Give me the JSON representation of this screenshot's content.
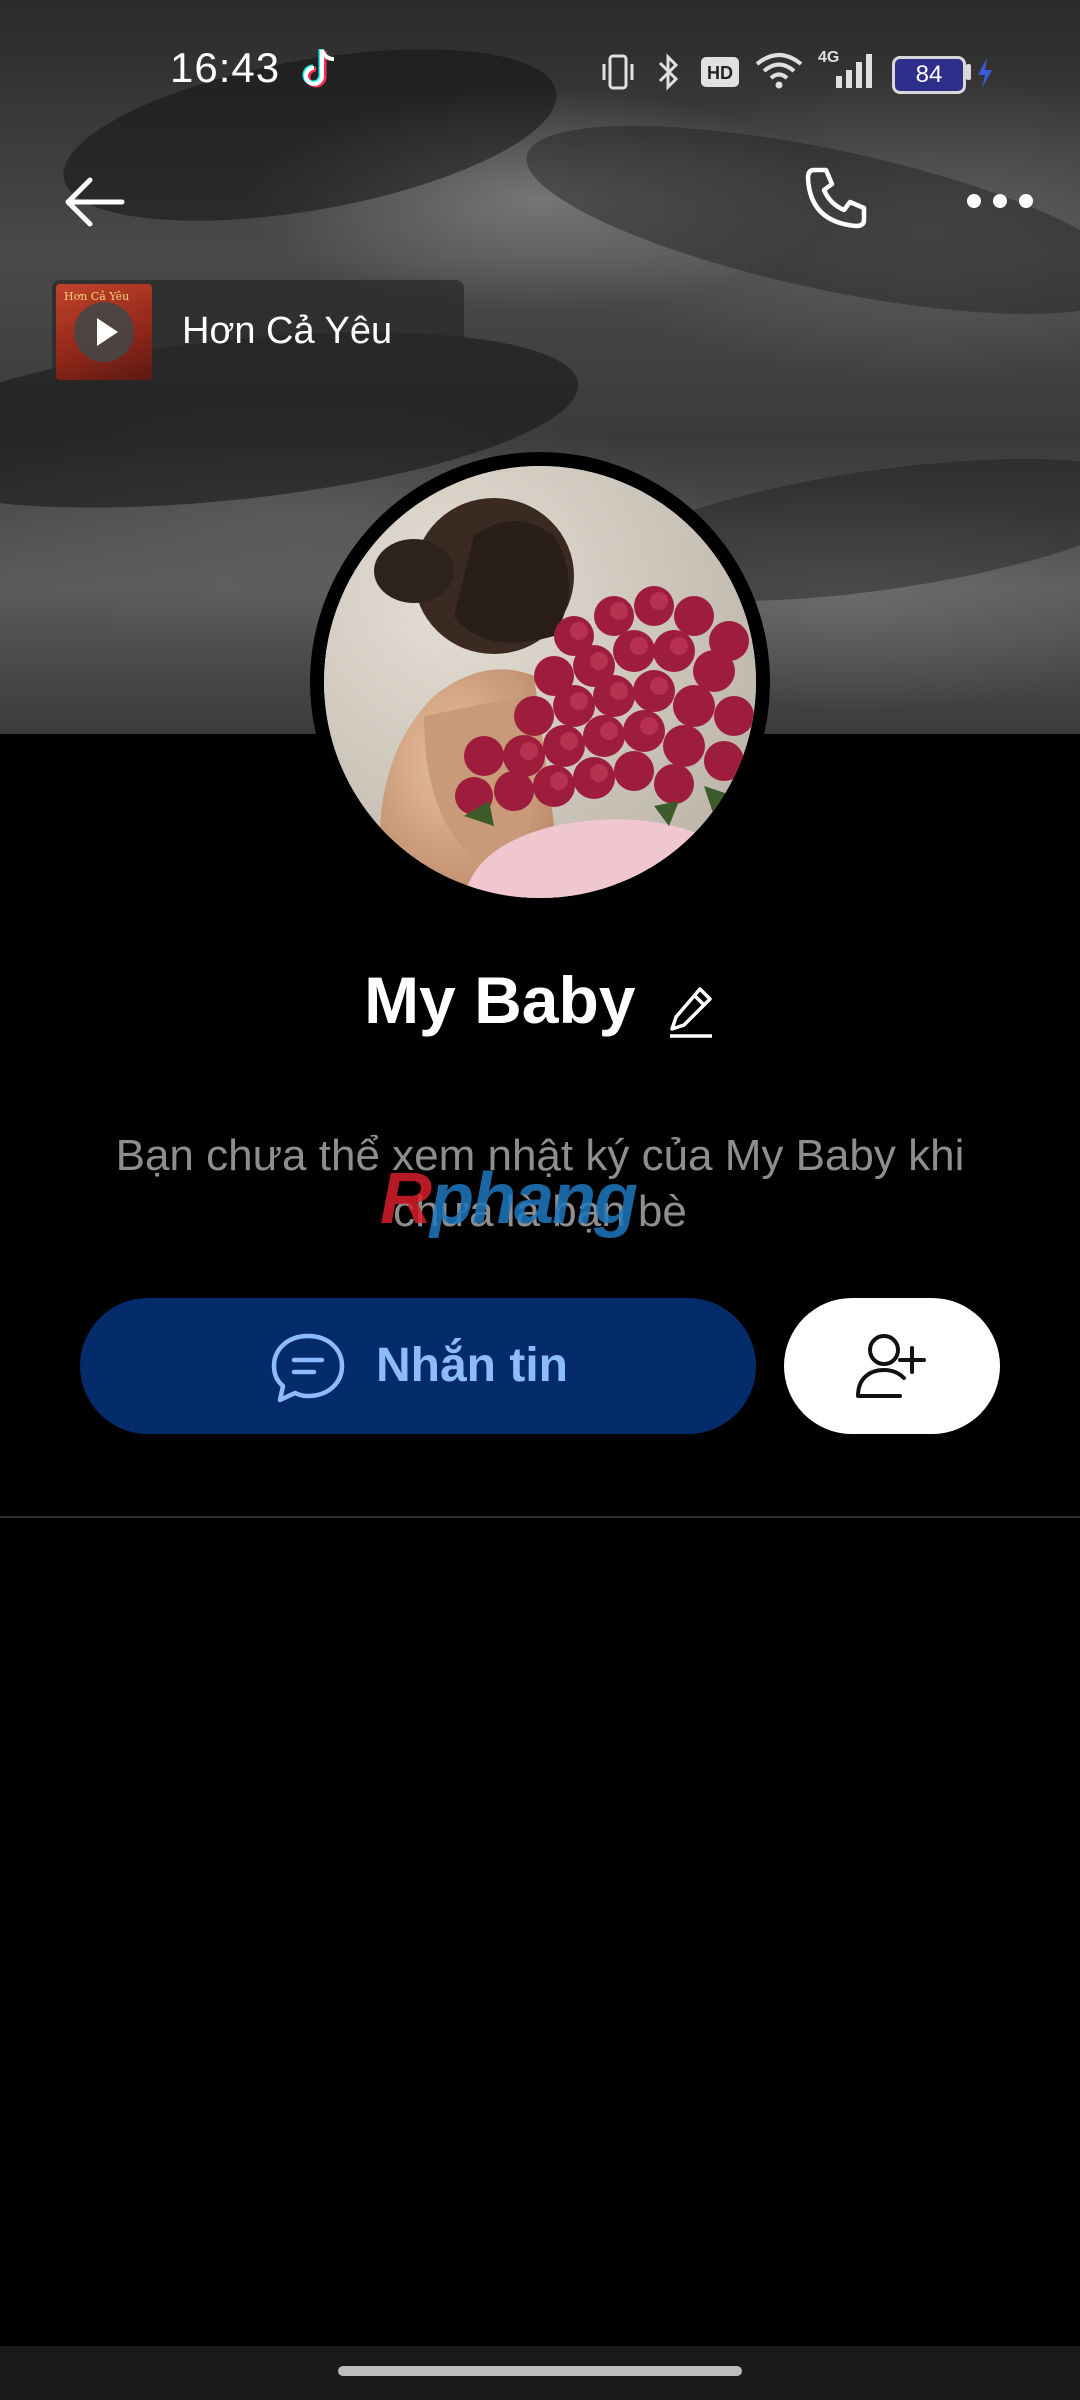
{
  "status_bar": {
    "time": "16:43",
    "battery": "84",
    "network": "4G",
    "hd": "HD"
  },
  "top_nav": {
    "back_icon": "arrow-left-icon",
    "call_icon": "phone-icon",
    "more_icon": "more-horizontal-icon"
  },
  "music": {
    "title": "Hơn Cả Yêu",
    "cover_text": "Hơn Cả Yêu"
  },
  "profile": {
    "name": "My Baby",
    "notice": "Bạn chưa thể xem nhật ký của My Baby khi chưa là bạn bè"
  },
  "watermark": {
    "text_red": "R",
    "text_blue": "phang"
  },
  "actions": {
    "message_label": "Nhắn tin",
    "message_icon": "chat-bubble-icon",
    "add_friend_icon": "user-plus-icon"
  },
  "colors": {
    "message_button_bg": "#042c6b",
    "message_button_text": "#8cbcff",
    "add_button_bg": "#ffffff",
    "background": "#000000",
    "notice_text": "#8e8e8e"
  }
}
